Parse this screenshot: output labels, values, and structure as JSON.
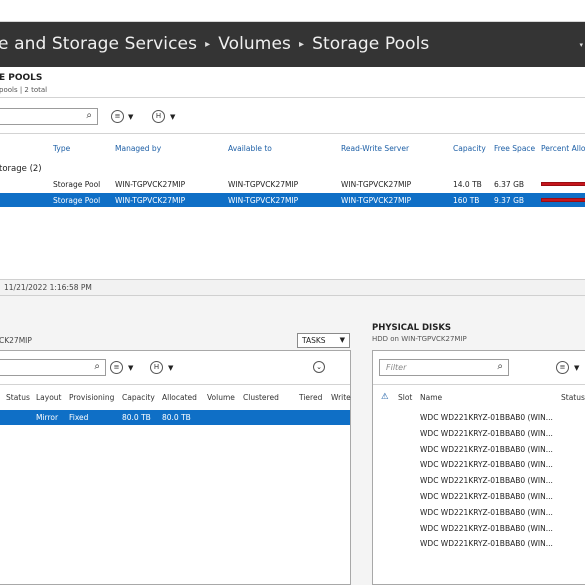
{
  "header": {
    "crumbs": [
      "e and Storage Services",
      "Volumes",
      "Storage Pools"
    ],
    "separator": "▸",
    "dropdown_glyph": "▾"
  },
  "pools": {
    "title": "E POOLS",
    "subtitle": "pools | 2 total",
    "filter_placeholder": "",
    "search_glyph": "⌕",
    "list_glyph": "≡",
    "save_glyph": "H",
    "caret": "▼",
    "columns": [
      "Type",
      "Managed by",
      "Available to",
      "Read-Write Server",
      "Capacity",
      "Free Space",
      "Percent Allo"
    ],
    "group_label": "torage (2)",
    "rows": [
      {
        "type": "Storage Pool",
        "managed_by": "WIN-TGPVCK27MIP",
        "available_to": "WIN-TGPVCK27MIP",
        "rw_server": "WIN-TGPVCK27MIP",
        "capacity": "14.0 TB",
        "free_space": "6.37 GB",
        "percent_allocated": 0.99
      },
      {
        "type": "Storage Pool",
        "managed_by": "WIN-TGPVCK27MIP",
        "available_to": "WIN-TGPVCK27MIP",
        "rw_server": "WIN-TGPVCK27MIP",
        "capacity": "160 TB",
        "free_space": "9.37 GB",
        "percent_allocated": 0.99,
        "selected": true
      }
    ]
  },
  "refresh": {
    "text": "11/21/2022 1:16:58 PM"
  },
  "vdisks": {
    "subtitle": "CK27MIP",
    "tasks_label": "TASKS",
    "tasks_caret": "▼",
    "chevron": "⌄",
    "search_glyph": "⌕",
    "list_glyph": "≡",
    "save_glyph": "H",
    "caret": "▼",
    "columns": [
      "Status",
      "Layout",
      "Provisioning",
      "Capacity",
      "Allocated",
      "Volume",
      "Clustered",
      "Tiered",
      "Write"
    ],
    "row": {
      "layout": "Mirror",
      "provisioning": "Fixed",
      "capacity": "80.0 TB",
      "allocated": "80.0 TB"
    }
  },
  "pdisks": {
    "title": "PHYSICAL DISKS",
    "subtitle": "HDD on WIN-TGPVCK27MIP",
    "filter_placeholder": "Filter",
    "search_glyph": "⌕",
    "list_glyph": "≡",
    "caret": "▼",
    "warn_glyph": "⚠",
    "columns": [
      "Slot",
      "Name",
      "Status"
    ],
    "disks": [
      "WDC WD221KRYZ-01BBAB0 (WIN...",
      "WDC WD221KRYZ-01BBAB0 (WIN...",
      "WDC WD221KRYZ-01BBAB0 (WIN...",
      "WDC WD221KRYZ-01BBAB0 (WIN...",
      "WDC WD221KRYZ-01BBAB0 (WIN...",
      "WDC WD221KRYZ-01BBAB0 (WIN...",
      "WDC WD221KRYZ-01BBAB0 (WIN...",
      "WDC WD221KRYZ-01BBAB0 (WIN...",
      "WDC WD221KRYZ-01BBAB0 (WIN..."
    ]
  },
  "colors": {
    "header_bg": "#343434",
    "selection": "#0f6fc6",
    "link": "#1d5fa6",
    "bar": "#c5161d"
  }
}
